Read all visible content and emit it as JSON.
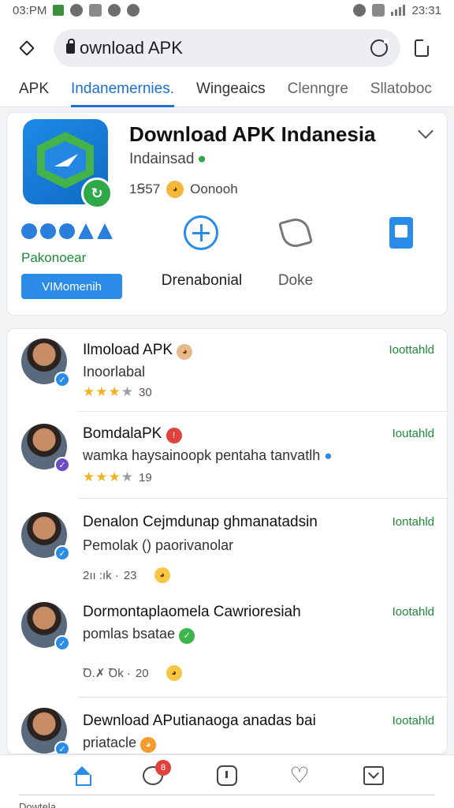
{
  "status_bar": {
    "time_left": "03:PM",
    "time_right": "23:31"
  },
  "browser": {
    "url": "ownload APK"
  },
  "tabs": [
    {
      "label": "APK"
    },
    {
      "label": "Indanemernies."
    },
    {
      "label": "Wingeaics"
    },
    {
      "label": "Clenngre"
    },
    {
      "label": "Sllatoboc"
    }
  ],
  "app": {
    "title": "Download APK Indanesia",
    "developer": "Indainsad",
    "meta": "1Ꞩ57",
    "meta_extra": "Oonooh",
    "sub_label": "Pakonoear",
    "button_label": "VIMomenih",
    "actions": [
      {
        "label": "",
        "icon": "plus-circle-icon"
      },
      {
        "label": "Drenabonial",
        "icon": "fold-icon"
      },
      {
        "label": "Doke",
        "icon": "book-icon"
      }
    ]
  },
  "reviews": [
    {
      "title": "Ilmoload APK",
      "tag": "Ioottahld",
      "line": "Inoorlabal",
      "meta": "30",
      "rating": 3
    },
    {
      "title": "BomdalaPK",
      "tag": "Ioutahld",
      "line": "wamka haysainoopk pentaha tanvatlh",
      "meta": "19",
      "rating": 3
    },
    {
      "title": "Denalon Cejmdunap ghmanatadsin",
      "tag": "Iontahld",
      "line": "Pemolak () paorivanolar",
      "meta": "23",
      "meta_prefix": "2ıı :ık ·"
    },
    {
      "title": "Dormontaplaomela Cawrioresiah",
      "tag": "Iootahld",
      "line": "pomlas bsatae",
      "meta": "20",
      "meta_prefix": "Ꝺ.✗ Ꝺk ·"
    },
    {
      "title": "Dewnload APutianaoga anadas bai",
      "tag": "Iootahld",
      "line": "priatacle"
    }
  ],
  "bottom_nav": {
    "chat_badge": "8",
    "caption": "Dowtela"
  },
  "colors": {
    "accent": "#2a8ce6",
    "green": "#1e8a3a",
    "star": "#f2b227"
  }
}
